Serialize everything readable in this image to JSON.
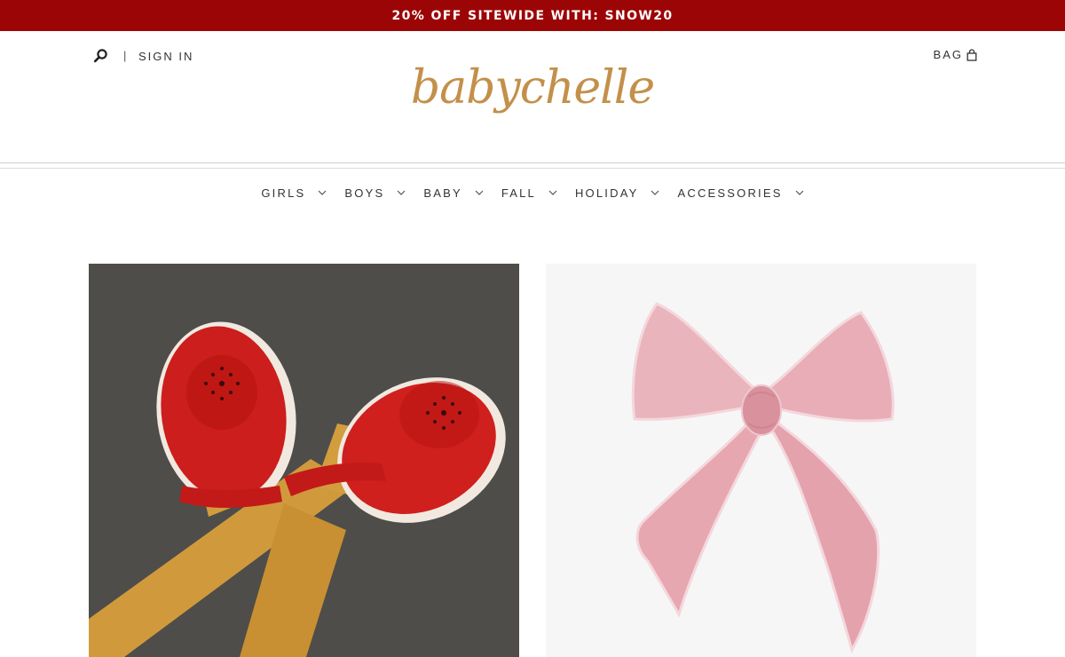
{
  "promo": {
    "text": "20% OFF SITEWIDE WITH: SNOW20"
  },
  "header": {
    "search_icon": "search-icon",
    "divider": "|",
    "sign_in": "SIGN IN",
    "bag_label": "BAG",
    "bag_icon": "shopping-bag-icon",
    "logo_text": "babychelle"
  },
  "nav": {
    "items": [
      {
        "label": "GIRLS"
      },
      {
        "label": "BOYS"
      },
      {
        "label": "BABY"
      },
      {
        "label": "FALL"
      },
      {
        "label": "HOLIDAY"
      },
      {
        "label": "ACCESSORIES"
      }
    ],
    "chevron_icon": "chevron-down-icon"
  },
  "colors": {
    "promo_bg": "#9c0506",
    "logo": "#c3904a",
    "text": "#333333"
  }
}
